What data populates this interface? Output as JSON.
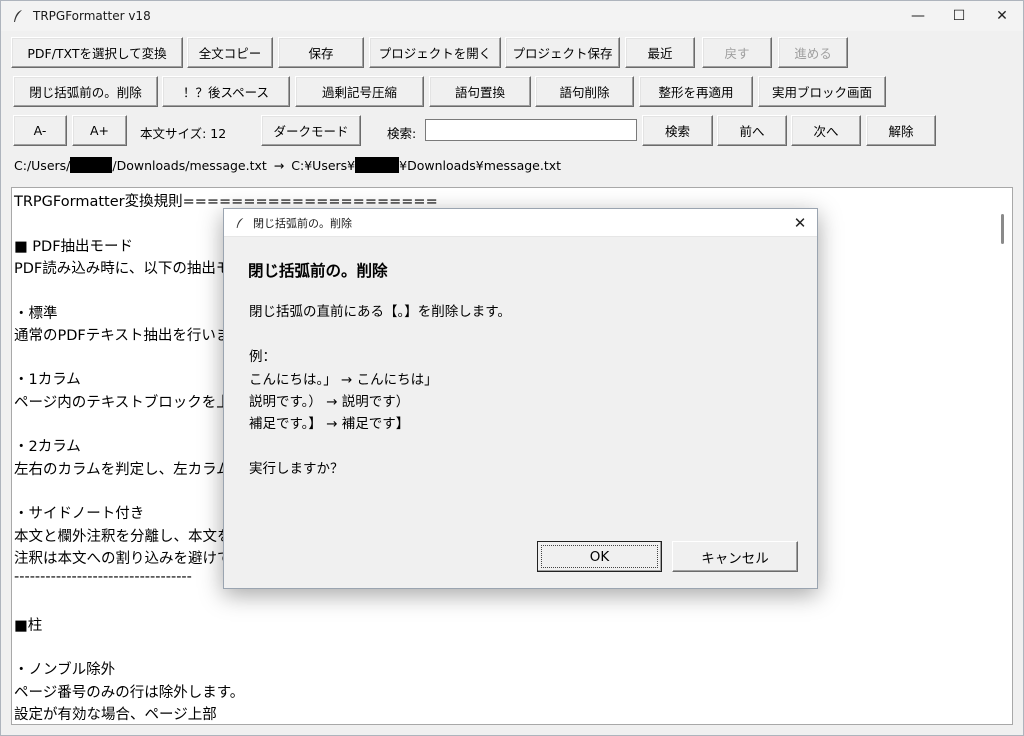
{
  "window": {
    "title": "TRPGFormatter v18",
    "controls": {
      "minimize": "—",
      "maximize": "☐",
      "close": "✕"
    }
  },
  "toolbar": {
    "row1": [
      "PDF/TXTを選択して変換",
      "全文コピー",
      "保存",
      "プロジェクトを開く",
      "プロジェクト保存",
      "最近",
      "戻す",
      "進める"
    ],
    "row2": [
      "閉じ括弧前の。削除",
      "！？後スペース",
      "過剰記号圧縮",
      "語句置換",
      "語句削除",
      "整形を再適用",
      "実用ブロック画面"
    ],
    "row3": {
      "font_minus": "A-",
      "font_plus": "A+",
      "font_size_label": "本文サイズ: 12",
      "dark_mode": "ダークモード",
      "search_label": "検索:",
      "search_value": "",
      "search_button": "検索",
      "prev_button": "前へ",
      "next_button": "次へ",
      "clear_button": "解除"
    }
  },
  "paths": {
    "input_prefix": "C:/Users/",
    "input_suffix": "/Downloads/message.txt",
    "arrow": "→",
    "output_prefix": "C:¥Users¥",
    "output_suffix": "¥Downloads¥message.txt"
  },
  "editor": {
    "lines": [
      "TRPGFormatter変換規則=====================",
      "",
      "■ PDF抽出モード",
      "PDF読み込み時に、以下の抽出モ",
      "",
      "・標準",
      "通常のPDFテキスト抽出を行いま",
      "",
      "・1カラム",
      "ページ内のテキストブロックを上",
      "",
      "・2カラム",
      "左右のカラムを判定し、左カラム",
      "",
      "・サイドノート付き",
      "本文と欄外注釈を分離し、本文を",
      "注釈は本文への割り込みを避けて",
      "----------------------------------",
      "",
      "■柱",
      "",
      "・ノンブル除外",
      "ページ番号のみの行は除外します。",
      "設定が有効な場合、ページ上部"
    ]
  },
  "dialog": {
    "title": "閉じ括弧前の。削除",
    "heading": "閉じ括弧前の。削除",
    "body": [
      "閉じ括弧の直前にある【。】を削除します。",
      "",
      "例：",
      "こんにちは。」 → こんにちは」",
      "説明です。） → 説明です）",
      "補足です。】 → 補足です】",
      "",
      "実行しますか？"
    ],
    "ok": "OK",
    "cancel": "キャンセル",
    "close": "✕"
  }
}
